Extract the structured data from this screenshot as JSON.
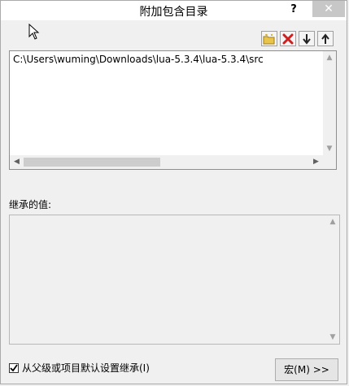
{
  "window": {
    "title": "附加包含目录",
    "help_label": "?",
    "close_label": "✕"
  },
  "toolbar": {
    "new_line_icon": "new-folder-icon",
    "delete_icon": "delete-icon",
    "move_down_icon": "arrow-down-icon",
    "move_up_icon": "arrow-up-icon"
  },
  "directories": {
    "items": [
      "C:\\Users\\wuming\\Downloads\\lua-5.3.4\\lua-5.3.4\\src"
    ]
  },
  "inherited": {
    "label": "继承的值:"
  },
  "footer": {
    "inherit_checkbox_label": "从父级或项目默认设置继承(I)",
    "inherit_checked": true,
    "macro_button_label": "宏(M) >>"
  },
  "colors": {
    "delete_red": "#cc1f1f",
    "folder_yellow": "#e8c44a",
    "close_bg": "#c7c7c7"
  }
}
